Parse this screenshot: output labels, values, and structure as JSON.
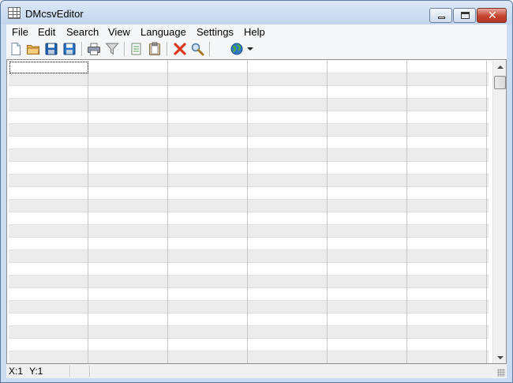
{
  "window": {
    "title": "DMcsvEditor",
    "close_glyph": "✕"
  },
  "menu": {
    "items": [
      "File",
      "Edit",
      "Search",
      "View",
      "Language",
      "Settings",
      "Help"
    ]
  },
  "toolbar": {
    "icons": [
      "new-file-icon",
      "open-folder-icon",
      "save-icon",
      "save-as-icon",
      "print-icon",
      "filter-icon",
      "copy-icon",
      "paste-icon",
      "delete-icon",
      "search-icon",
      "globe-icon",
      "dropdown-arrow-icon"
    ]
  },
  "grid": {
    "columns": 6,
    "rows": 24,
    "stripe_color": "#ececec"
  },
  "status": {
    "x": "X:1",
    "y": "Y:1"
  }
}
